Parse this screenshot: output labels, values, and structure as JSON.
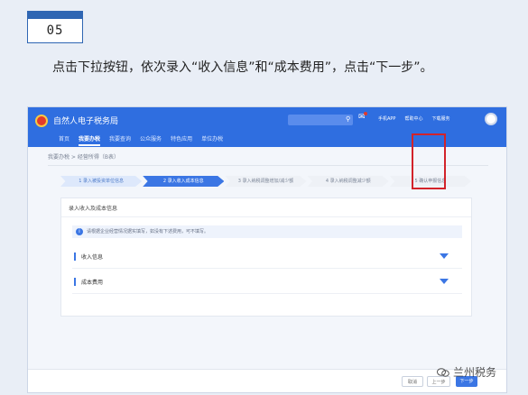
{
  "step_badge": {
    "number": "05"
  },
  "instruction": "点击下拉按钮，依次录入“收入信息”和“成本费用”，点击“下一步”。",
  "app": {
    "title": "自然人电子税务局",
    "nav": [
      "首页",
      "我要办税",
      "我要查询",
      "公众服务",
      "特色应用",
      "单位办税"
    ],
    "active_nav": "我要办税",
    "top_links": [
      "手机APP",
      "帮助中心",
      "下载服务"
    ],
    "breadcrumb": "我要办税 > 经营所得（B表）",
    "steps": [
      "1 录入被投资单位信息",
      "2 录入收入成本信息",
      "3 录入纳税调整增加/减少额",
      "4 录入纳税调整减少额",
      "5 确认申报信息"
    ],
    "panel_title": "录入收入及成本信息",
    "notice": "请根据企业经营情况据实填写，如没有下述费用，可不填写。",
    "sections": {
      "income": "收入信息",
      "cost": "成本费用"
    },
    "buttons": {
      "cancel": "取消",
      "prev": "上一步",
      "next": "下一步"
    }
  },
  "watermark": "兰州税务",
  "colors": {
    "brand_blue": "#2f6ee0",
    "highlight_red": "#d2232a"
  }
}
